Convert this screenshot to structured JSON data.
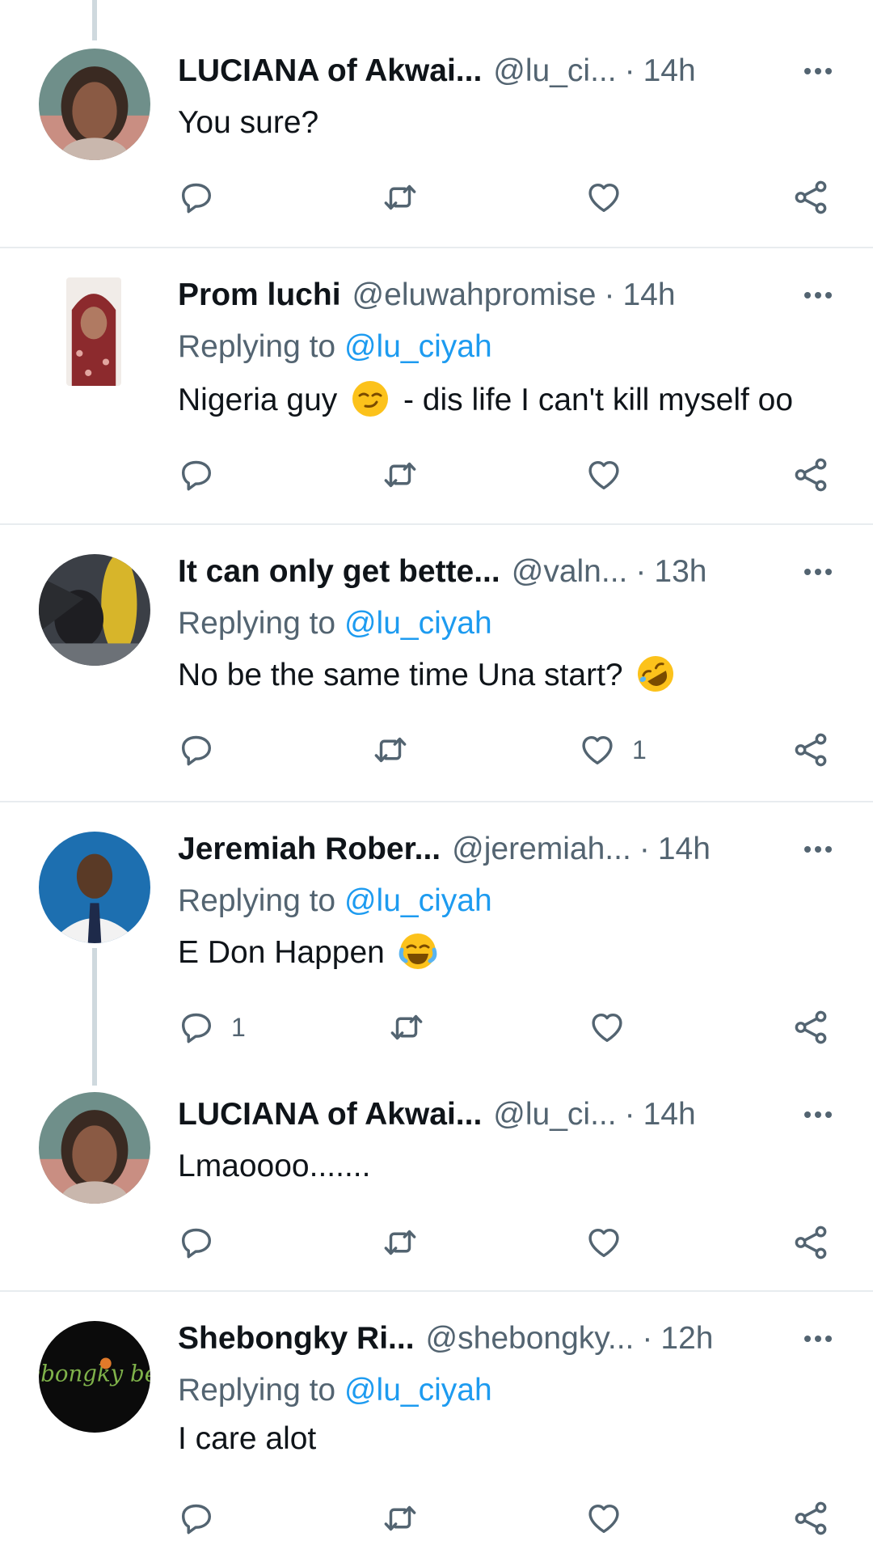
{
  "colors": {
    "accent": "#1d9bf0",
    "muted": "#536471",
    "text": "#0f1419",
    "divider": "#e8ecef",
    "thread": "#cfd9de"
  },
  "replies": [
    {
      "name": "LUCIANA of Akwai...",
      "handle": "@lu_ci...",
      "separator": "·",
      "time": "14h",
      "replying_label": "",
      "replying_to": "",
      "text": "You sure?",
      "emoji": "",
      "reply_count": "",
      "like_count": ""
    },
    {
      "name": "Prom luchi",
      "handle": "@eluwahpromise",
      "separator": "·",
      "time": "14h",
      "replying_label": "Replying to",
      "replying_to": "@lu_ciyah",
      "text_before": "Nigeria guy",
      "emoji": "smirking-face",
      "text_after": "- dis life I can't kill myself oo",
      "reply_count": "",
      "like_count": ""
    },
    {
      "name": "It can only get bette...",
      "handle": "@valn...",
      "separator": "·",
      "time": "13h",
      "replying_label": "Replying to",
      "replying_to": "@lu_ciyah",
      "text": "No be the same time Una start?",
      "emoji": "rolling-on-floor-laughing",
      "reply_count": "",
      "like_count": "1"
    },
    {
      "name": "Jeremiah Rober...",
      "handle": "@jeremiah...",
      "separator": "·",
      "time": "14h",
      "replying_label": "Replying to",
      "replying_to": "@lu_ciyah",
      "text": "E Don Happen",
      "emoji": "face-with-tears-of-joy",
      "reply_count": "1",
      "like_count": ""
    },
    {
      "name": "LUCIANA of Akwai...",
      "handle": "@lu_ci...",
      "separator": "·",
      "time": "14h",
      "replying_label": "",
      "replying_to": "",
      "text": "Lmaoooo.......",
      "emoji": "",
      "reply_count": "",
      "like_count": ""
    },
    {
      "name": "Shebongky Ri...",
      "handle": "@shebongky...",
      "separator": "·",
      "time": "12h",
      "replying_label": "Replying to",
      "replying_to": "@lu_ciyah",
      "text": "I care alot",
      "emoji": "",
      "reply_count": "",
      "like_count": ""
    }
  ],
  "icons": {
    "reply": "reply-icon",
    "retweet": "retweet-icon",
    "like": "heart-icon",
    "share": "share-icon",
    "more": "more-icon"
  },
  "avatars": [
    "avatar-luciana",
    "avatar-prom-luchi",
    "avatar-bat-corn",
    "avatar-jeremiah",
    "avatar-luciana",
    "avatar-shebongky-beats"
  ],
  "avatar_text": "Shebongky beats"
}
